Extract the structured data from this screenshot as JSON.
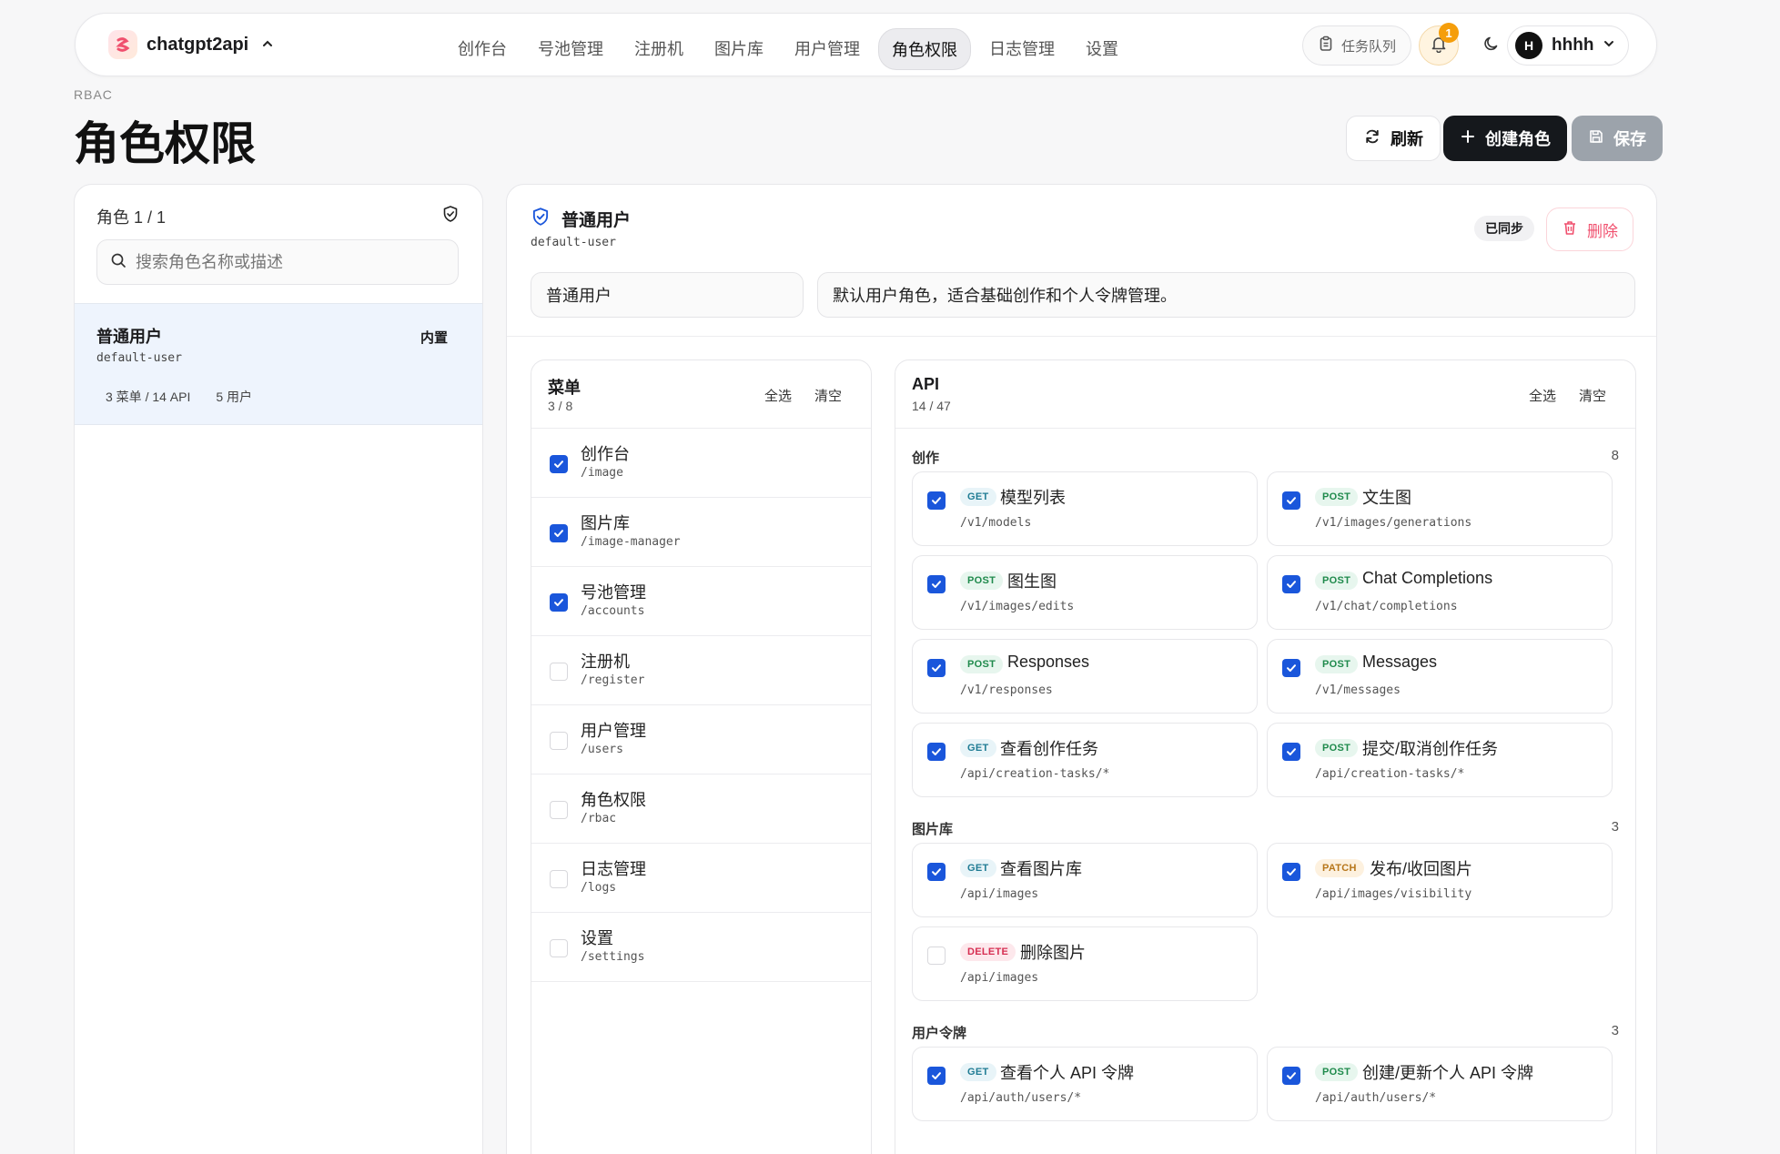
{
  "nav": {
    "brand": "chatgpt2api",
    "links": [
      "创作台",
      "号池管理",
      "注册机",
      "图片库",
      "用户管理",
      "角色权限",
      "日志管理",
      "设置"
    ],
    "active_index": 5,
    "tasks_label": "任务队列",
    "notification_count": "1",
    "user_initial": "H",
    "username": "hhhh"
  },
  "header": {
    "eyebrow": "RBAC",
    "title": "角色权限",
    "refresh_label": "刷新",
    "create_label": "创建角色",
    "save_label": "保存"
  },
  "roles_panel": {
    "title": "角色 1 / 1",
    "search_placeholder": "搜索角色名称或描述",
    "roles": [
      {
        "name": "普通用户",
        "key": "default-user",
        "tag": "内置",
        "menu_api": "3 菜单 / 14 API",
        "users": "5 用户"
      }
    ]
  },
  "detail": {
    "name": "普通用户",
    "key": "default-user",
    "sync_status": "已同步",
    "delete_label": "删除",
    "name_value": "普通用户",
    "description_value": "默认用户角色，适合基础创作和个人令牌管理。",
    "select_all": "全选",
    "clear": "清空",
    "menu": {
      "title": "菜单",
      "count": "3 / 8",
      "items": [
        {
          "label": "创作台",
          "path": "/image",
          "checked": true
        },
        {
          "label": "图片库",
          "path": "/image-manager",
          "checked": true
        },
        {
          "label": "号池管理",
          "path": "/accounts",
          "checked": true
        },
        {
          "label": "注册机",
          "path": "/register",
          "checked": false
        },
        {
          "label": "用户管理",
          "path": "/users",
          "checked": false
        },
        {
          "label": "角色权限",
          "path": "/rbac",
          "checked": false
        },
        {
          "label": "日志管理",
          "path": "/logs",
          "checked": false
        },
        {
          "label": "设置",
          "path": "/settings",
          "checked": false
        }
      ]
    },
    "api": {
      "title": "API",
      "count": "14 / 47",
      "groups": [
        {
          "name": "创作",
          "count": "8",
          "items": [
            {
              "method": "GET",
              "label": "模型列表",
              "path": "/v1/models",
              "checked": true
            },
            {
              "method": "POST",
              "label": "文生图",
              "path": "/v1/images/generations",
              "checked": true
            },
            {
              "method": "POST",
              "label": "图生图",
              "path": "/v1/images/edits",
              "checked": true
            },
            {
              "method": "POST",
              "label": "Chat Completions",
              "path": "/v1/chat/completions",
              "checked": true
            },
            {
              "method": "POST",
              "label": "Responses",
              "path": "/v1/responses",
              "checked": true
            },
            {
              "method": "POST",
              "label": "Messages",
              "path": "/v1/messages",
              "checked": true
            },
            {
              "method": "GET",
              "label": "查看创作任务",
              "path": "/api/creation-tasks/*",
              "checked": true
            },
            {
              "method": "POST",
              "label": "提交/取消创作任务",
              "path": "/api/creation-tasks/*",
              "checked": true
            }
          ]
        },
        {
          "name": "图片库",
          "count": "3",
          "items": [
            {
              "method": "GET",
              "label": "查看图片库",
              "path": "/api/images",
              "checked": true
            },
            {
              "method": "PATCH",
              "label": "发布/收回图片",
              "path": "/api/images/visibility",
              "checked": true
            },
            {
              "method": "DELETE",
              "label": "删除图片",
              "path": "/api/images",
              "checked": false
            }
          ]
        },
        {
          "name": "用户令牌",
          "count": "3",
          "items": [
            {
              "method": "GET",
              "label": "查看个人 API 令牌",
              "path": "/api/auth/users/*",
              "checked": true
            },
            {
              "method": "POST",
              "label": "创建/更新个人 API 令牌",
              "path": "/api/auth/users/*",
              "checked": true
            }
          ]
        }
      ]
    }
  }
}
